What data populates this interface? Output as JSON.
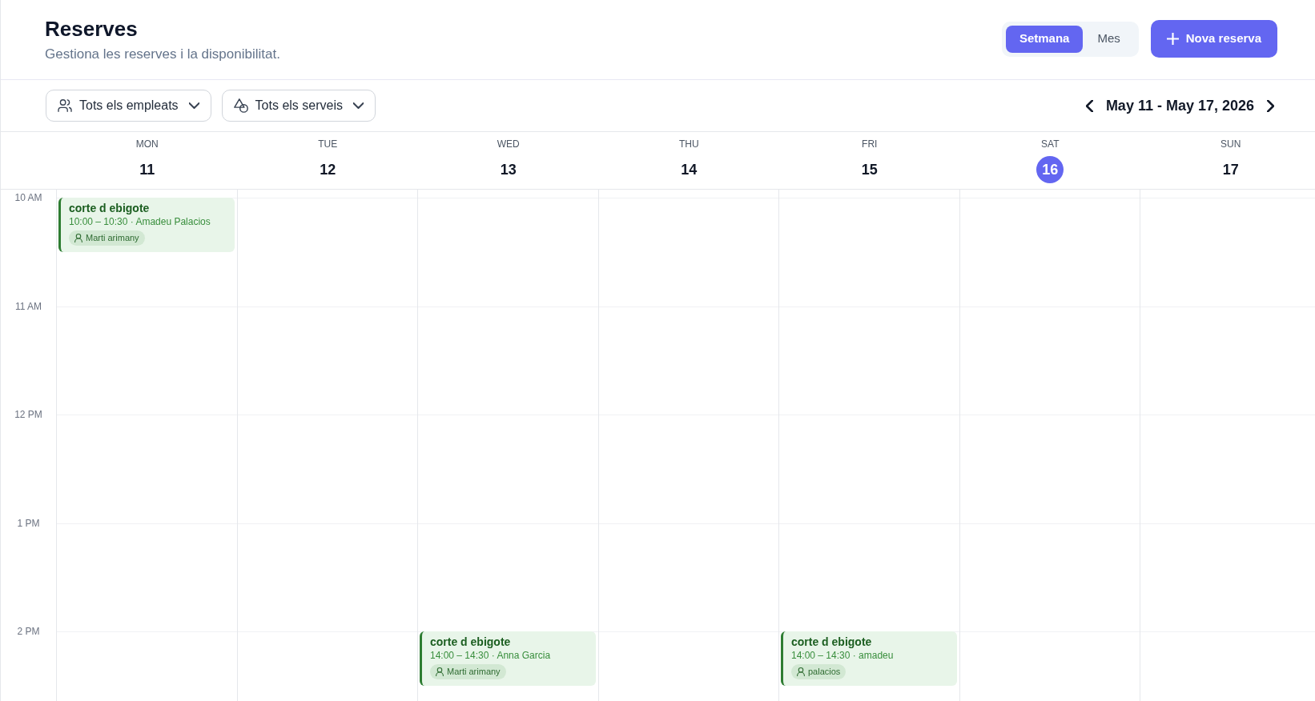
{
  "header": {
    "title": "Reserves",
    "subtitle": "Gestiona les reserves i la disponibilitat."
  },
  "view_toggle": [
    {
      "label": "Setmana",
      "selected": true
    },
    {
      "label": "Mes",
      "selected": false
    }
  ],
  "new_button": {
    "label": "Nova reserva"
  },
  "filters": [
    {
      "kind": "staff",
      "label": "Tots els empleats"
    },
    {
      "kind": "services",
      "label": "Tots els serveis"
    }
  ],
  "date_nav": {
    "range": "May 11 - May 17, 2026"
  },
  "hours": [
    "10 AM",
    "11 AM",
    "12 PM",
    "1 PM",
    "2 PM"
  ],
  "days": [
    {
      "weekday": "MON",
      "date": "11",
      "today": false,
      "events": [
        {
          "title": "corte d ebigote",
          "details": "10:00 – 10:30 · Amadeu Palacios",
          "client": "Marti arimany"
        }
      ]
    },
    {
      "weekday": "TUE",
      "date": "12",
      "today": false
    },
    {
      "weekday": "WED",
      "date": "13",
      "today": false,
      "events": [
        {
          "title": "corte d ebigote",
          "details": "14:00 – 14:30 · Anna Garcia",
          "client": "Marti arimany"
        }
      ]
    },
    {
      "weekday": "THU",
      "date": "14",
      "today": false
    },
    {
      "weekday": "FRI",
      "date": "15",
      "today": false,
      "events": [
        {
          "title": "corte d ebigote",
          "details": "14:00 – 14:30 · amadeu",
          "client": "palacios"
        }
      ]
    },
    {
      "weekday": "SAT",
      "date": "16",
      "today": true
    },
    {
      "weekday": "SUN",
      "date": "17",
      "today": false
    }
  ]
}
